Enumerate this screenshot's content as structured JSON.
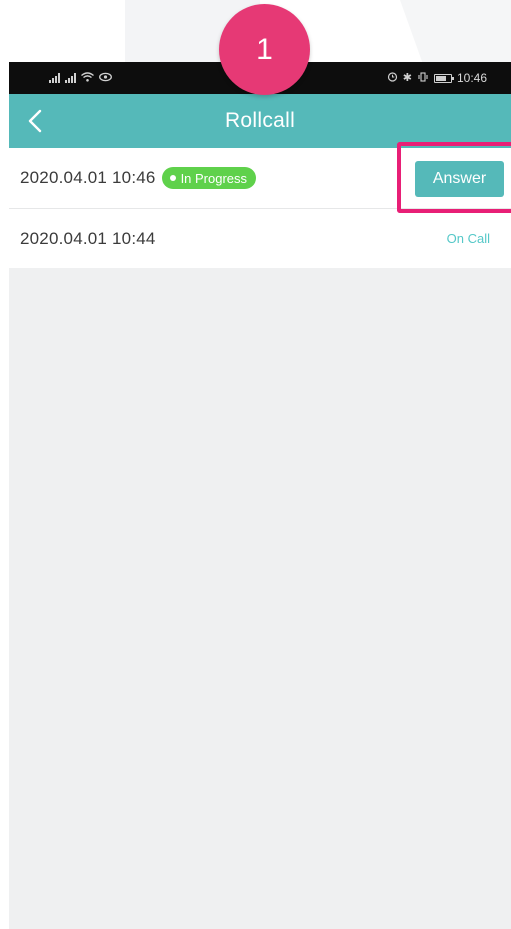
{
  "tutorial": {
    "step_number": "1",
    "highlight_color": "#e81f76",
    "badge_color": "#e63975"
  },
  "status_bar": {
    "left_icons": [
      "signal-icon",
      "signal-icon",
      "wifi-icon",
      "eye-icon"
    ],
    "right_icons": [
      "alarm-icon",
      "bluetooth-icon",
      "vibrate-icon",
      "battery-icon"
    ],
    "time": "10:46"
  },
  "header": {
    "title": "Rollcall",
    "back_icon": "chevron-left-icon",
    "background": "#55b9b9"
  },
  "rollcalls": [
    {
      "time": "2020.04.01 10:46",
      "status_badge": "In Progress",
      "action_label": "Answer"
    },
    {
      "time": "2020.04.01 10:44",
      "action_label": "On Call"
    }
  ]
}
